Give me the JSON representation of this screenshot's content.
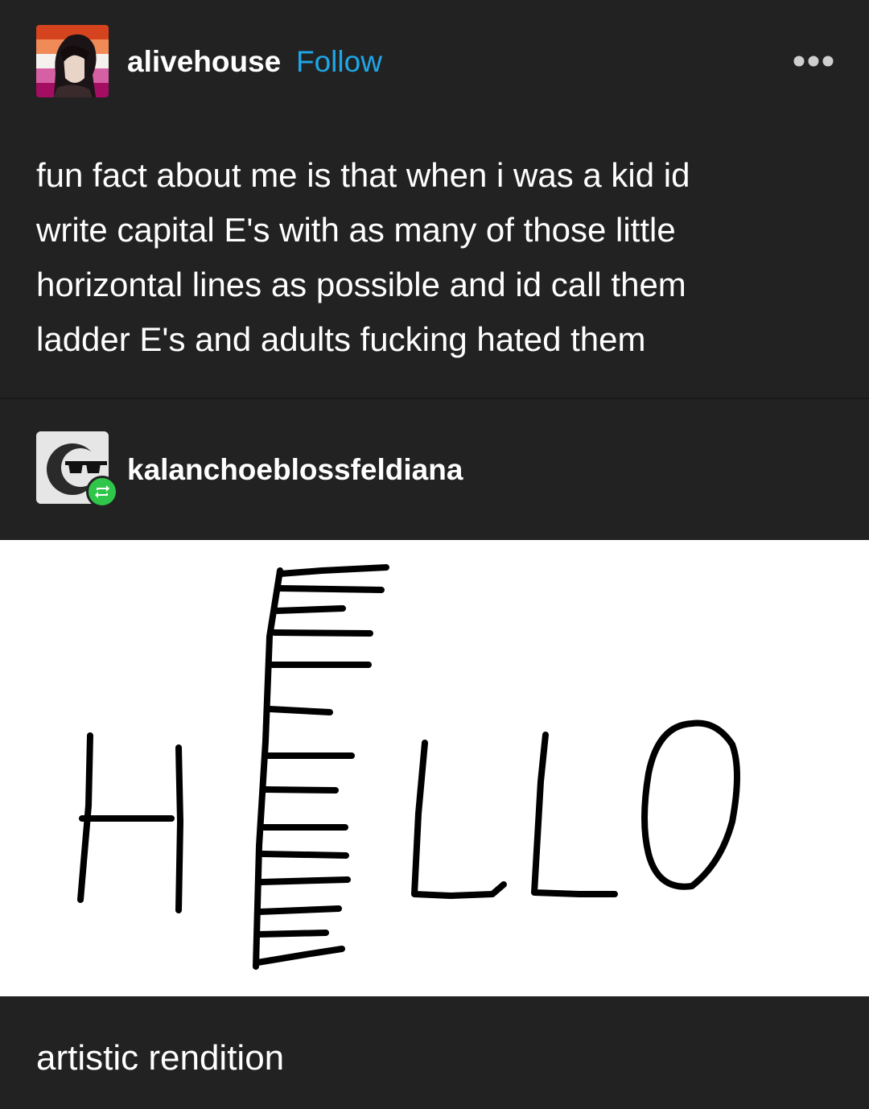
{
  "post": {
    "author": "alivehouse",
    "follow_label": "Follow",
    "more_icon": "ellipsis-icon",
    "text": "fun fact about me is that when i was a kid id\nwrite capital E's with as many of those little\nhorizontal lines as possible and id call them\nladder E's and adults fucking hated them"
  },
  "reblog": {
    "author": "kalanchoeblossfeldiana",
    "badge_icon": "reblog-icon",
    "caption": "artistic rendition"
  },
  "colors": {
    "background": "#222222",
    "accent": "#1ea7e8",
    "reblog_badge": "#2fc64a"
  }
}
